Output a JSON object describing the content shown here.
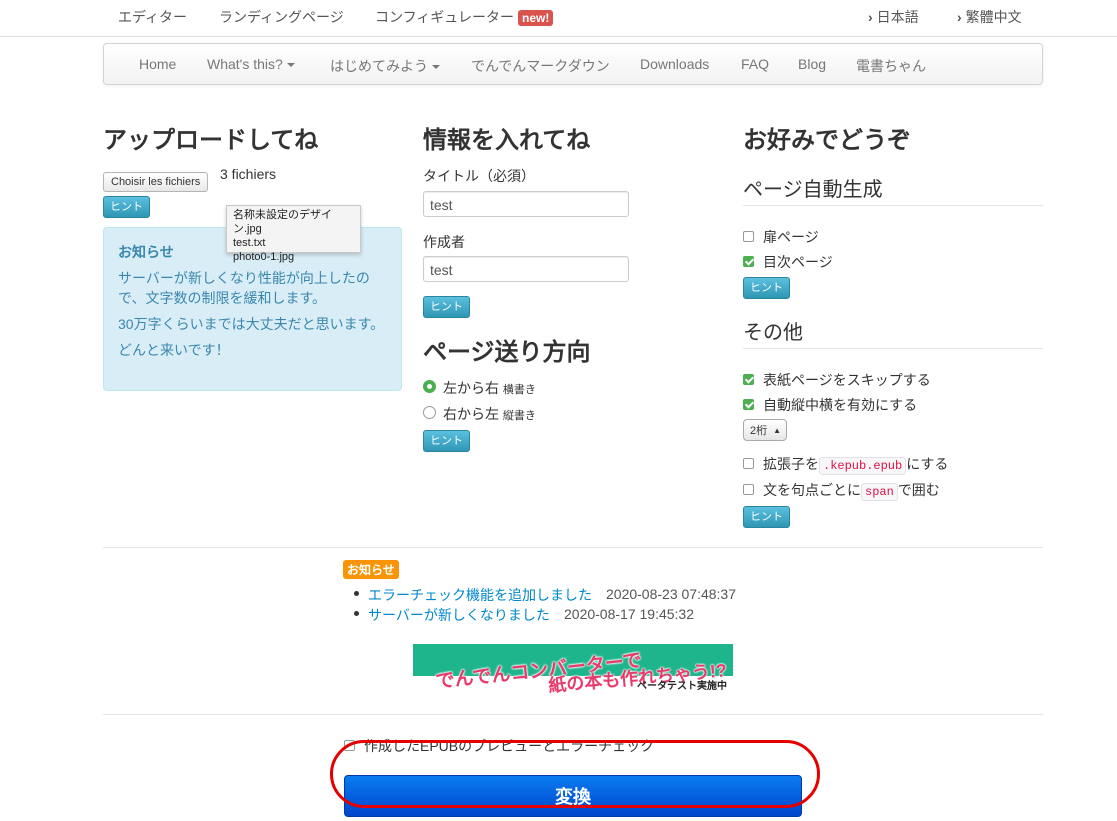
{
  "topbar": {
    "links": [
      "エディター",
      "ランディングページ",
      "コンフィギュレーター"
    ],
    "new_badge": "new!",
    "languages": [
      "日本語",
      "繁體中文"
    ]
  },
  "navbar": {
    "items": [
      "Home",
      "What's this?",
      "はじめてみよう",
      "でんでんマークダウン",
      "Downloads",
      "FAQ",
      "Blog",
      "電書ちゃん"
    ]
  },
  "upload": {
    "heading": "アップロードしてね",
    "file_button": "Choisir les fichiers",
    "file_count": "3 fichiers",
    "hint": "ヒント",
    "tooltip_files": [
      "名称未設定のデザイン.jpg",
      "test.txt",
      "photo0-1.jpg"
    ],
    "notice_title": "お知らせ",
    "notice_lines": [
      "サーバーが新しくなり性能が向上したので、文字数の制限を緩和します。",
      "30万字くらいまでは大丈夫だと思います。",
      "どんと来いです！"
    ]
  },
  "info": {
    "heading": "情報を入れてね",
    "title_label": "タイトル（必須）",
    "title_value": "test",
    "author_label": "作成者",
    "author_value": "test",
    "hint": "ヒント",
    "direction_heading": "ページ送り方向",
    "ltr_label": "左から右",
    "ltr_sub": "横書き",
    "rtl_label": "右から左",
    "rtl_sub": "縦書き",
    "direction_hint": "ヒント"
  },
  "prefs": {
    "heading": "お好みでどうぞ",
    "autogen_heading": "ページ自動生成",
    "title_page": "扉ページ",
    "toc_page": "目次ページ",
    "hint1": "ヒント",
    "other_heading": "その他",
    "skip_cover": "表紙ページをスキップする",
    "tcy": "自動縦中横を有効にする",
    "tcy_select": "2桁",
    "ext_prefix": "拡張子を",
    "ext_code": ".kepub.epub",
    "ext_suffix": "にする",
    "span_prefix": "文を句点ごとに",
    "span_code": "span",
    "span_suffix": "で囲む",
    "hint2": "ヒント"
  },
  "news": {
    "badge": "お知らせ",
    "items": [
      {
        "title": "エラーチェック機能を追加しました",
        "date": "2020-08-23 07:48:37"
      },
      {
        "title": "サーバーが新しくなりました",
        "date": "2020-08-17 19:45:32"
      }
    ]
  },
  "banner": {
    "line1": "でんでんコンバーターで",
    "line2": "紙の本も作れちゃう!?",
    "line3": "ベータテスト実施中"
  },
  "footer": {
    "preview_label": "作成したEPUBのプレビューとエラーチェック",
    "convert_button": "変換"
  },
  "colors": {
    "link": "#0088cc",
    "hint_button": "#2f96b4",
    "convert_button": "#0044cc",
    "annotation_circle": "#e50000"
  }
}
